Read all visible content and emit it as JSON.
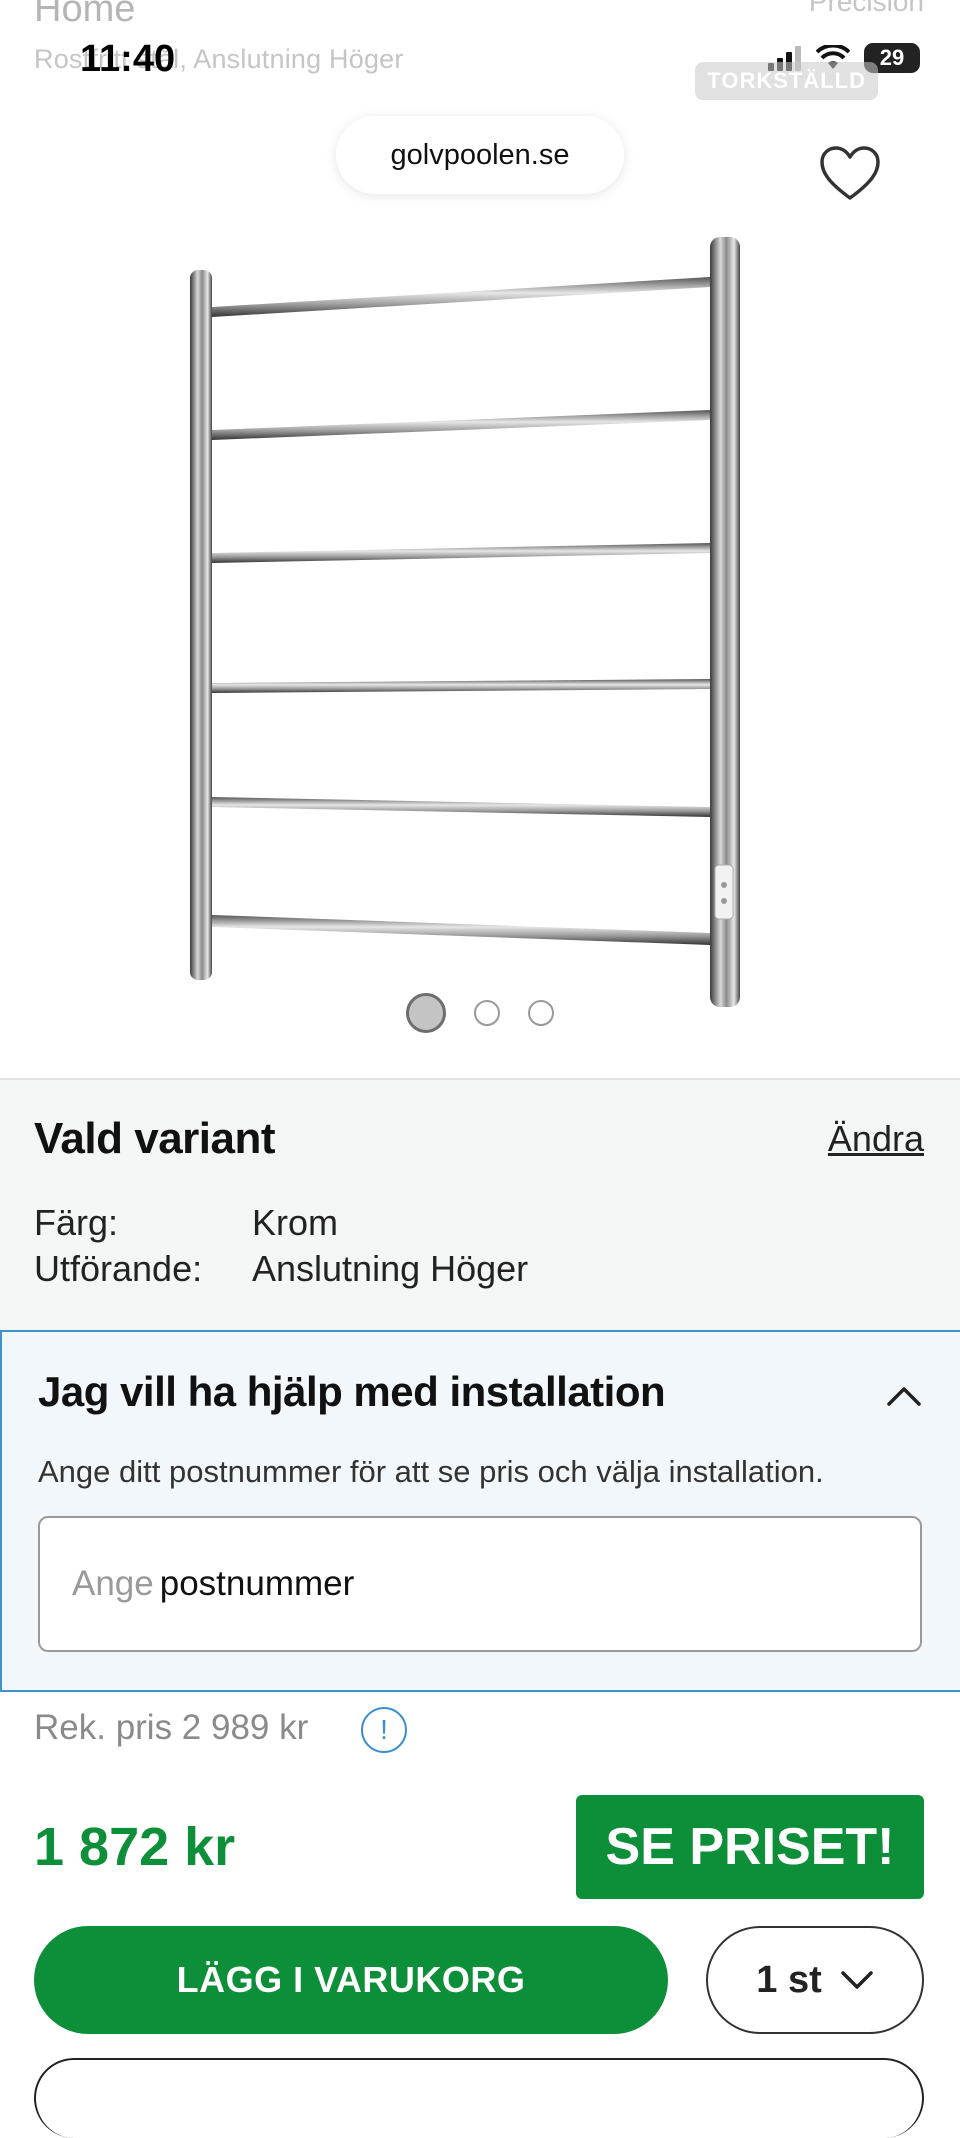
{
  "behind": {
    "home": "Home",
    "crumb": "Rostfritt stål, Anslutning Höger",
    "right": "Precision"
  },
  "statusbar": {
    "time": "11:40",
    "tag": "TORKSTÄLLD",
    "battery": "29"
  },
  "browser": {
    "url": "golvpoolen.se"
  },
  "gallery": {
    "dots": 3,
    "active_index": 0
  },
  "variant": {
    "title": "Vald variant",
    "change": "Ändra",
    "color_label": "Färg:",
    "color_value": "Krom",
    "model_label": "Utförande:",
    "model_value": "Anslutning Höger"
  },
  "install": {
    "title": "Jag vill ha hjälp med installation",
    "description": "Ange ditt postnummer för att se pris och välja installation.",
    "input_placeholder": "Ange",
    "input_value": "postnummer"
  },
  "pricing": {
    "rek": "Rek. pris 2 989 kr",
    "info": "!",
    "price": "1 872 kr",
    "see_price": "SE PRISET!"
  },
  "cart": {
    "add_label": "LÄGG I VARUKORG",
    "qty_label": "1 st"
  },
  "colors": {
    "green": "#0d8f3a",
    "blue_border": "#3b93c7"
  }
}
